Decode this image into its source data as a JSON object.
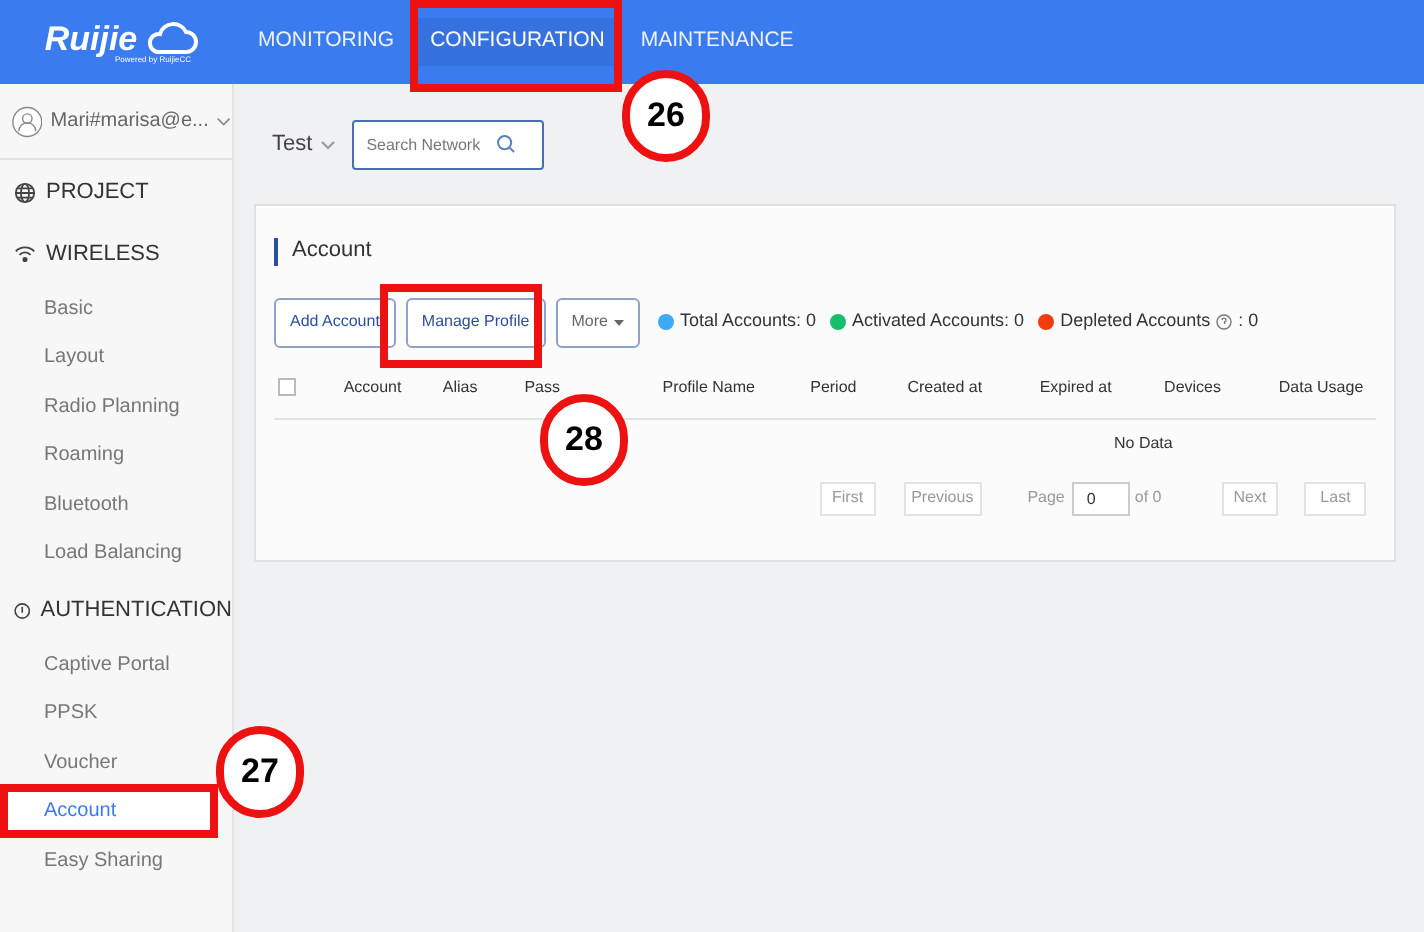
{
  "header": {
    "logo": "Ruijie",
    "logo_tagline": "Powered by RuijieCC",
    "nav": [
      {
        "label": "MONITORING",
        "selected": false
      },
      {
        "label": "CONFIGURATION",
        "selected": true
      },
      {
        "label": "MAINTENANCE",
        "selected": false
      }
    ]
  },
  "user": {
    "name": "Mari#marisa@e..."
  },
  "sidebar": {
    "sections": [
      {
        "title": "PROJECT",
        "kind": "globe"
      },
      {
        "title": "WIRELESS",
        "kind": "wifi",
        "children": [
          {
            "label": "Basic",
            "selected": false
          },
          {
            "label": "Layout",
            "selected": false
          },
          {
            "label": "Radio Planning",
            "selected": false
          },
          {
            "label": "Roaming",
            "selected": false
          },
          {
            "label": "Bluetooth",
            "selected": false
          },
          {
            "label": "Load Balancing",
            "selected": false
          }
        ]
      },
      {
        "title": "AUTHENTICATION",
        "kind": "shield",
        "children": [
          {
            "label": "Captive Portal",
            "selected": false
          },
          {
            "label": "PPSK",
            "selected": false
          },
          {
            "label": "Voucher",
            "selected": false
          },
          {
            "label": "Account",
            "selected": true
          },
          {
            "label": "Easy Sharing",
            "selected": false
          }
        ]
      }
    ]
  },
  "toolbar": {
    "network": "Test",
    "search": {
      "placeholder": "Search Network"
    }
  },
  "card": {
    "title": "Account",
    "buttons": [
      "Add Account",
      "Manage Profile",
      "More"
    ],
    "stats": [
      {
        "label": "Total Accounts: 0",
        "color": "#3fa9f5"
      },
      {
        "label": "Activated Accounts: 0",
        "color": "#19be6b"
      },
      {
        "label": "Depleted Accounts",
        "color": "#f03c0f",
        "suffix": ": 0"
      }
    ],
    "table": {
      "select_all": {
        "checked": false
      },
      "columns": [
        "Account",
        "Alias",
        "Pass",
        "Profile Name",
        "Period",
        "Created at",
        "Expired at",
        "Devices",
        "Data Usage"
      ],
      "empty": "No Data"
    },
    "pagination": {
      "first": "First",
      "previous": "Previous",
      "page": "Page",
      "value": "0",
      "of": "of 0",
      "next": "Next",
      "last": "Last"
    }
  },
  "callouts": [
    {
      "label": "26"
    },
    {
      "label": "27"
    },
    {
      "label": "28"
    }
  ]
}
